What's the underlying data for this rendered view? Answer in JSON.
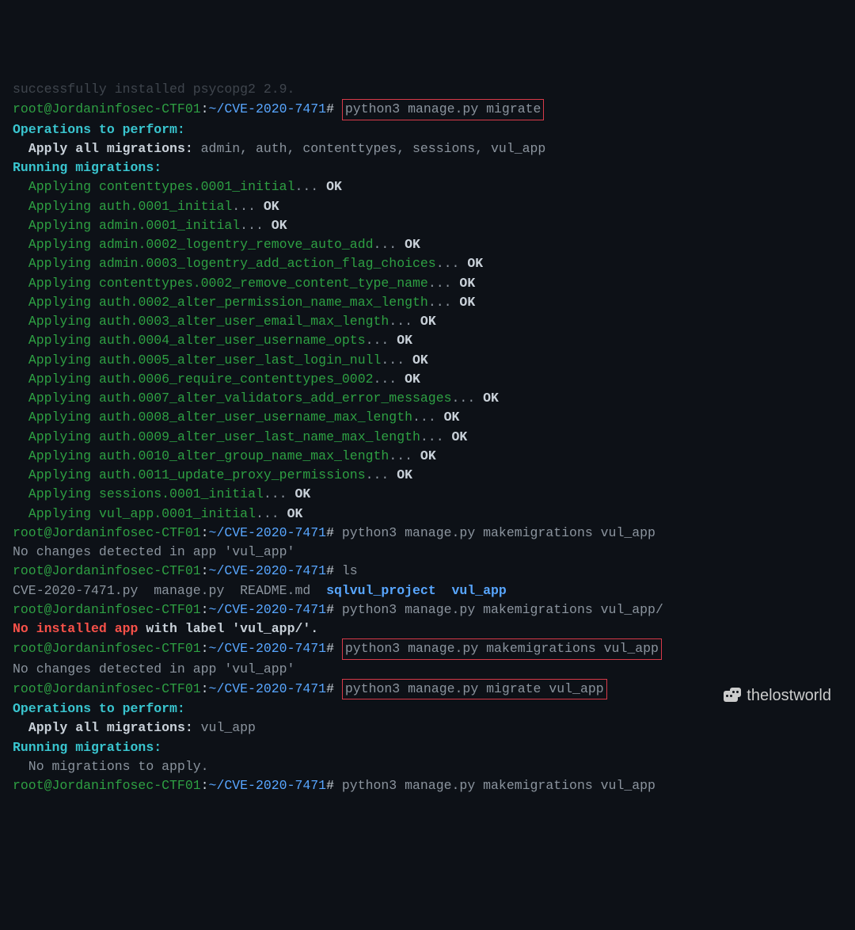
{
  "topline": "successfully installed psycopg2 2.9.",
  "prompt": {
    "user": "root@Jordaninfosec-CTF01",
    "sep": ":",
    "path": "~/CVE-2020-7471",
    "hash": "#"
  },
  "commands": {
    "migrate": "python3 manage.py migrate",
    "makemigrations": "python3 manage.py makemigrations vul_app",
    "ls": "ls",
    "makemigrations_slash": "python3 manage.py makemigrations vul_app/",
    "migrate_vul": "python3 manage.py migrate vul_app"
  },
  "headers": {
    "ops": "Operations to perform:",
    "apply_all": "Apply all migrations:",
    "apply_list_full": " admin, auth, contenttypes, sessions, vul_app",
    "running": "Running migrations:",
    "apply_list_vul": " vul_app"
  },
  "migrations": [
    "contenttypes.0001_initial",
    "auth.0001_initial",
    "admin.0001_initial",
    "admin.0002_logentry_remove_auto_add",
    "admin.0003_logentry_add_action_flag_choices",
    "contenttypes.0002_remove_content_type_name",
    "auth.0002_alter_permission_name_max_length",
    "auth.0003_alter_user_email_max_length",
    "auth.0004_alter_user_username_opts",
    "auth.0005_alter_user_last_login_null",
    "auth.0006_require_contenttypes_0002",
    "auth.0007_alter_validators_add_error_messages",
    "auth.0008_alter_user_username_max_length",
    "auth.0009_alter_user_last_name_max_length",
    "auth.0010_alter_group_name_max_length",
    "auth.0011_update_proxy_permissions",
    "sessions.0001_initial",
    "vul_app.0001_initial"
  ],
  "applying": "Applying ",
  "dots": "...",
  "ok": " OK",
  "nochanges": "No changes detected in app 'vul_app'",
  "ls_output": {
    "files": "CVE-2020-7471.py  manage.py  README.md  ",
    "dir1": "sqlvul_project",
    "sep": "  ",
    "dir2": "vul_app"
  },
  "error": {
    "red": "No installed app",
    "mid": " with label ",
    "quoted": "'vul_app/'",
    "dot": "."
  },
  "no_migrations": "  No migrations to apply.",
  "watermark": "thelostworld"
}
